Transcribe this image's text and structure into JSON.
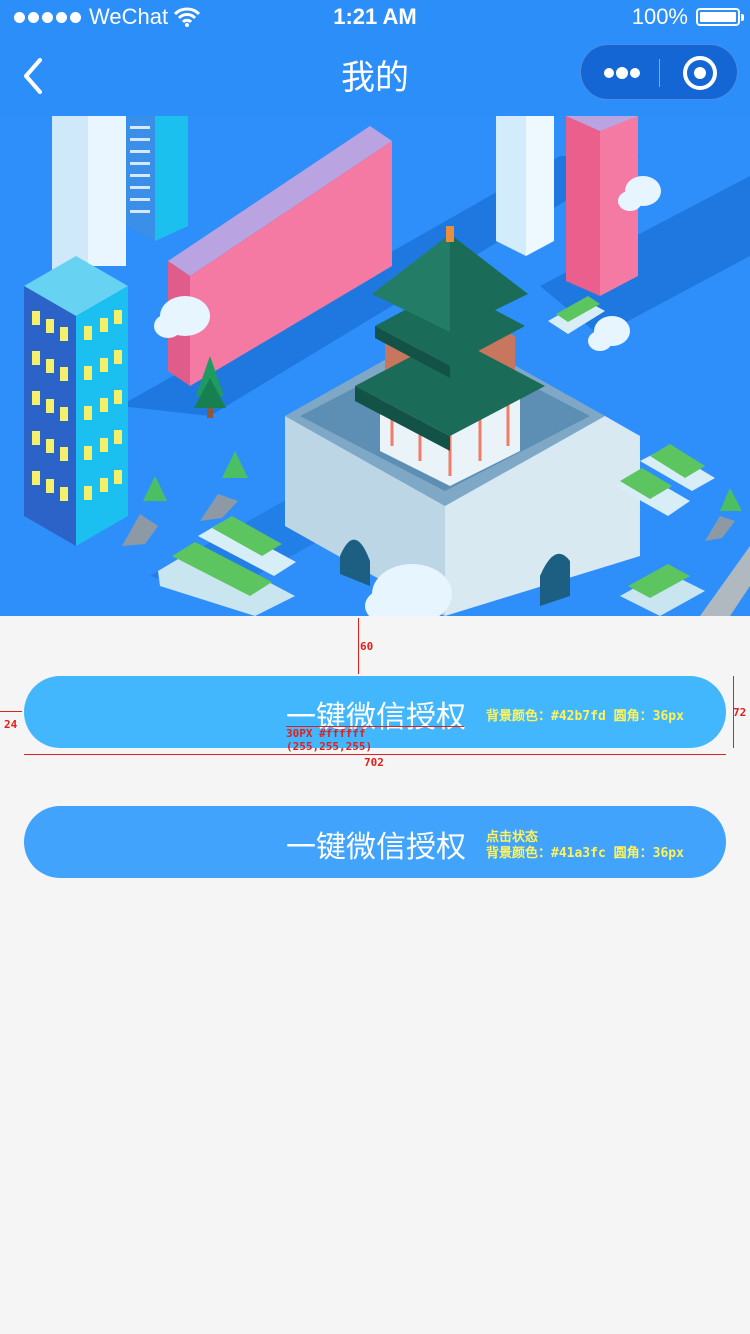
{
  "status_bar": {
    "carrier": "WeChat",
    "time": "1:21 AM",
    "battery_text": "100%",
    "battery_level": 1.0
  },
  "nav": {
    "title": "我的",
    "icons": {
      "back": "chevron-left-icon",
      "more": "more-dots-icon",
      "close": "target-circle-icon"
    }
  },
  "colors": {
    "nav_bg": "#2b8ef9",
    "button_normal": "#42b7fd",
    "button_pressed": "#41a3fc",
    "annotation_yellow": "#fff35a",
    "annotation_red": "#e0201a"
  },
  "buttons": [
    {
      "label": "一键微信授权",
      "note_line1": "背景颜色：#42b7fd 圆角：36px"
    },
    {
      "label": "一键微信授权",
      "note_line0": "点击状态",
      "note_line1": "背景颜色：#41a3fc 圆角：36px"
    }
  ],
  "annotations": {
    "gap_top": "60",
    "left_margin": "24",
    "height": "72",
    "width": "702",
    "font_spec": "30PX  #ffffff",
    "rgb_spec": "(255,255,255)"
  }
}
